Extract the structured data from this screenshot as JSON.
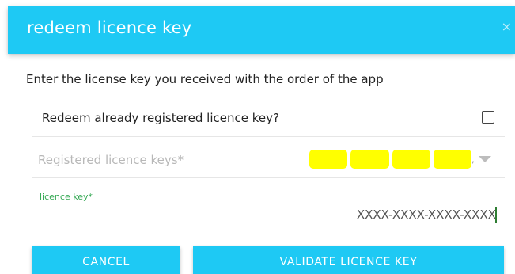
{
  "dialog": {
    "title": "redeem licence key",
    "close_symbol": "×",
    "intro": "Enter the license key you received with the order of the app"
  },
  "redeem_existing": {
    "label": "Redeem already registered licence key?",
    "checked": false
  },
  "registered_keys": {
    "placeholder": "Registered licence keys*",
    "selected_separator": ",",
    "dropdown_icon": "triangle-down-icon"
  },
  "licence_key": {
    "label": "licence key*",
    "value": "XXXX-XXXX-XXXX-XXXX"
  },
  "buttons": {
    "cancel": "CANCEL",
    "validate": "VALIDATE LICENCE KEY"
  },
  "colors": {
    "accent": "#1ec9f4",
    "label_focus": "#34a853",
    "redaction": "#ffff00"
  }
}
